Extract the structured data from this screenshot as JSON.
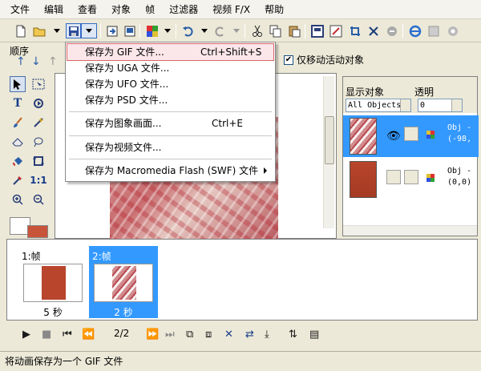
{
  "menubar": {
    "items": [
      "文件",
      "编辑",
      "查看",
      "对象",
      "帧",
      "过滤器",
      "视频 F/X",
      "帮助"
    ]
  },
  "toolbar": {
    "icons": [
      "new-icon",
      "open-icon",
      "save-icon",
      "import-icon",
      "export-icon",
      "color-icon",
      "undo-icon",
      "redo-icon",
      "cut-icon",
      "copy-icon",
      "paste-icon",
      "frame-icon",
      "resize-icon",
      "crop-icon",
      "effects-icon",
      "browser-icon",
      "disabled-icon",
      "help-icon"
    ]
  },
  "save_menu": {
    "items": [
      {
        "label": "保存为 GIF 文件...",
        "shortcut": "Ctrl+Shift+S"
      },
      {
        "label": "保存为 UGA 文件..."
      },
      {
        "label": "保存为 UFO 文件..."
      },
      {
        "label": "保存为 PSD 文件..."
      },
      {
        "label": "保存为图象画面...",
        "shortcut": "Ctrl+E"
      },
      {
        "label": "保存为视频文件..."
      },
      {
        "label": "保存为 Macromedia Flash (SWF) 文件"
      }
    ]
  },
  "left_panel": {
    "order_label": "顺序"
  },
  "move_active": {
    "label": "仅移动活动对象",
    "checked": true
  },
  "objects_panel": {
    "show_label": "显示对象",
    "opacity_label": "透明",
    "combo_value": "All Objects",
    "opacity_value": "0",
    "layers": [
      {
        "name": "Obj -",
        "coords": "(-98,",
        "selected": true
      },
      {
        "name": "Obj -",
        "coords": "(0,0)",
        "selected": false
      }
    ]
  },
  "frames": [
    {
      "title": "1:帧",
      "duration": "5 秒",
      "selected": false
    },
    {
      "title": "2:帧",
      "duration": "2 秒",
      "selected": true
    }
  ],
  "playback": {
    "page": "2/2"
  },
  "status": {
    "text": "将动画保存为一个 GIF 文件"
  },
  "colors": {
    "selection": "#3399ff",
    "menu_highlight": "#fbe6ea"
  }
}
